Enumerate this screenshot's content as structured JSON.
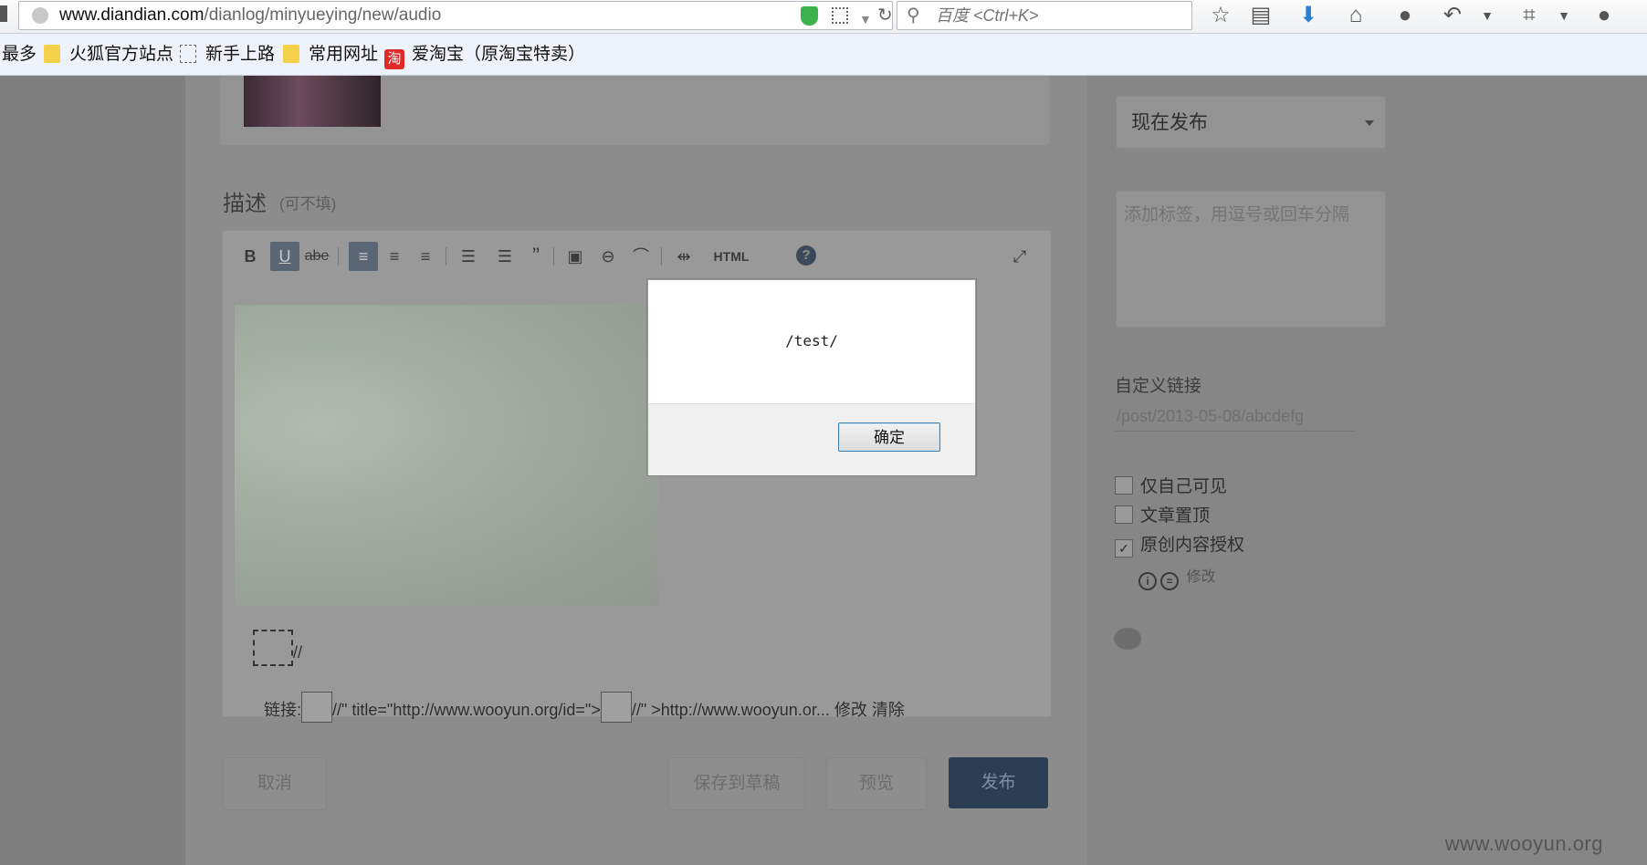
{
  "browser": {
    "url_host": "www.diandian.com",
    "url_path": "/dianlog/minyueying/new/audio",
    "search_placeholder": "百度 <Ctrl+K>",
    "bookmarks": [
      {
        "label": "最多",
        "icon": "none"
      },
      {
        "label": "火狐官方站点",
        "icon": "folder-icon"
      },
      {
        "label": "新手上路",
        "icon": "dashed-page-icon"
      },
      {
        "label": "常用网址",
        "icon": "folder-icon"
      },
      {
        "label": "爱淘宝（原淘宝特卖）",
        "icon": "taobao-icon"
      }
    ],
    "taobao_glyph": "淘"
  },
  "editor": {
    "title": "描述",
    "hint": "(可不填)",
    "toolbar": {
      "bold": "B",
      "underline": "U",
      "strike": "abe",
      "html": "HTML",
      "help": "?"
    },
    "broken_slash": "//",
    "link_label": "链接:",
    "link_mid": "//\" title=\"http://www.wooyun.org/id=\">",
    "link_end": "//\" >http://www.wooyun.or...",
    "link_edit": "修改",
    "link_clear": "清除"
  },
  "actions": {
    "cancel": "取消",
    "save_draft": "保存到草稿",
    "preview": "预览",
    "publish": "发布"
  },
  "sidebar": {
    "publish_time": "现在发布",
    "tags_placeholder": "添加标签，用逗号或回车分隔",
    "custom_link_title": "自定义链接",
    "custom_link_value": "/post/2013-05-08/abcdefg",
    "checkboxes": [
      {
        "label": "仅自己可见",
        "checked": false
      },
      {
        "label": "文章置顶",
        "checked": false
      },
      {
        "label": "原创内容授权",
        "checked": true
      }
    ],
    "license_edit": "修改"
  },
  "dialog": {
    "message": "/test/",
    "ok_label": "确定"
  },
  "watermark": "www.wooyun.org"
}
